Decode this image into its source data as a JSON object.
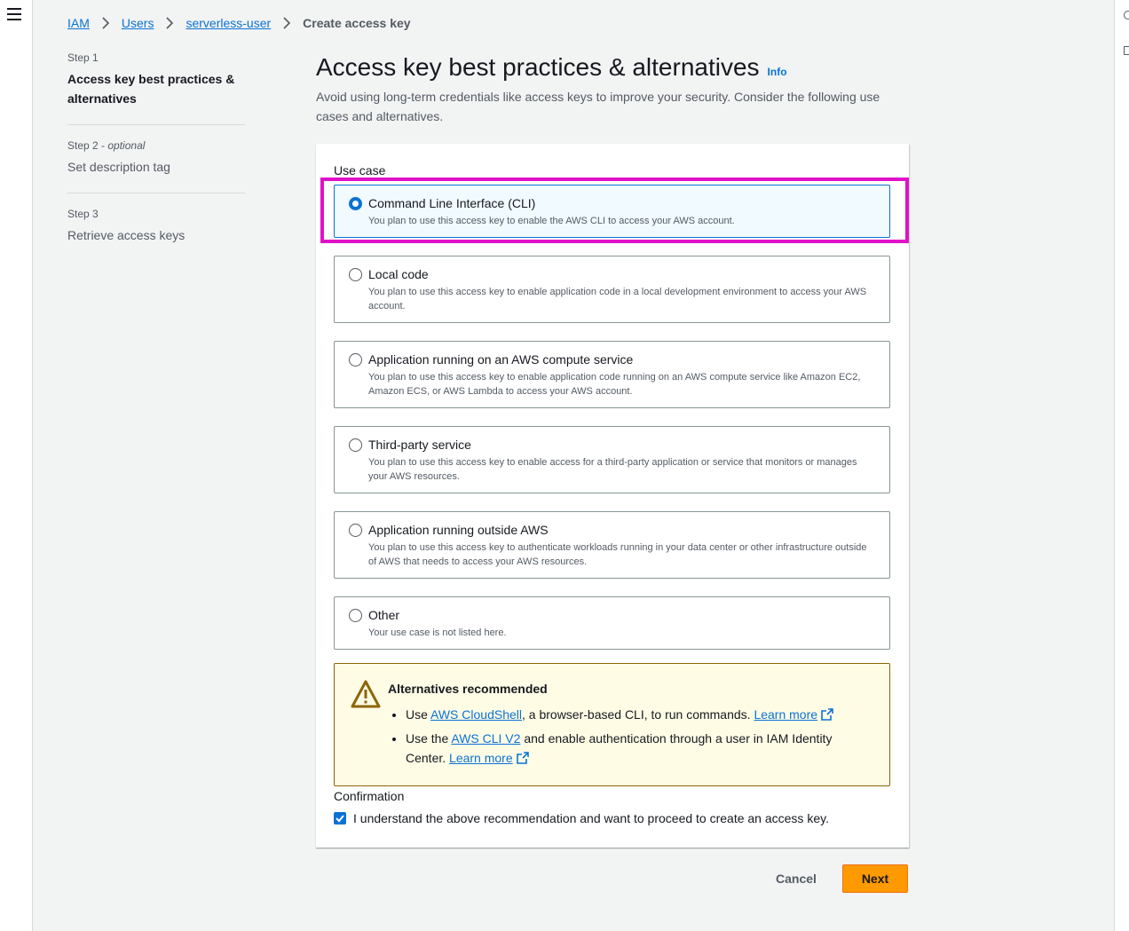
{
  "breadcrumb": {
    "items": [
      "IAM",
      "Users",
      "serverless-user"
    ],
    "current": "Create access key"
  },
  "steps": [
    {
      "label": "Step 1",
      "optional": "",
      "title": "Access key best practices & alternatives"
    },
    {
      "label": "Step 2",
      "optional": "optional",
      "title": "Set description tag"
    },
    {
      "label": "Step 3",
      "optional": "",
      "title": "Retrieve access keys"
    }
  ],
  "header": {
    "title": "Access key best practices & alternatives",
    "info": "Info",
    "description": "Avoid using long-term credentials like access keys to improve your security. Consider the following use cases and alternatives."
  },
  "use_case": {
    "label": "Use case",
    "selected_index": 0,
    "options": [
      {
        "title": "Command Line Interface (CLI)",
        "desc": "You plan to use this access key to enable the AWS CLI to access your AWS account."
      },
      {
        "title": "Local code",
        "desc": "You plan to use this access key to enable application code in a local development environment to access your AWS account."
      },
      {
        "title": "Application running on an AWS compute service",
        "desc": "You plan to use this access key to enable application code running on an AWS compute service like Amazon EC2, Amazon ECS, or AWS Lambda to access your AWS account."
      },
      {
        "title": "Third-party service",
        "desc": "You plan to use this access key to enable access for a third-party application or service that monitors or manages your AWS resources."
      },
      {
        "title": "Application running outside AWS",
        "desc": "You plan to use this access key to authenticate workloads running in your data center or other infrastructure outside of AWS that needs to access your AWS resources."
      },
      {
        "title": "Other",
        "desc": "Your use case is not listed here."
      }
    ]
  },
  "alert": {
    "title": "Alternatives recommended",
    "item1": {
      "pre": "Use ",
      "link": "AWS CloudShell",
      "post": ", a browser-based CLI, to run commands. ",
      "learn": "Learn more"
    },
    "item2": {
      "pre": "Use the ",
      "link": "AWS CLI V2",
      "post": " and enable authentication through a user in IAM Identity Center. ",
      "learn": "Learn more"
    }
  },
  "confirmation": {
    "label": "Confirmation",
    "checkbox_text": "I understand the above recommendation and want to proceed to create an access key.",
    "checked": true
  },
  "actions": {
    "cancel": "Cancel",
    "next": "Next"
  },
  "colors": {
    "accent": "#0972d3",
    "primary_button": "#ff9900",
    "highlight": "#e011c8",
    "warning_bg": "#fffce6"
  }
}
